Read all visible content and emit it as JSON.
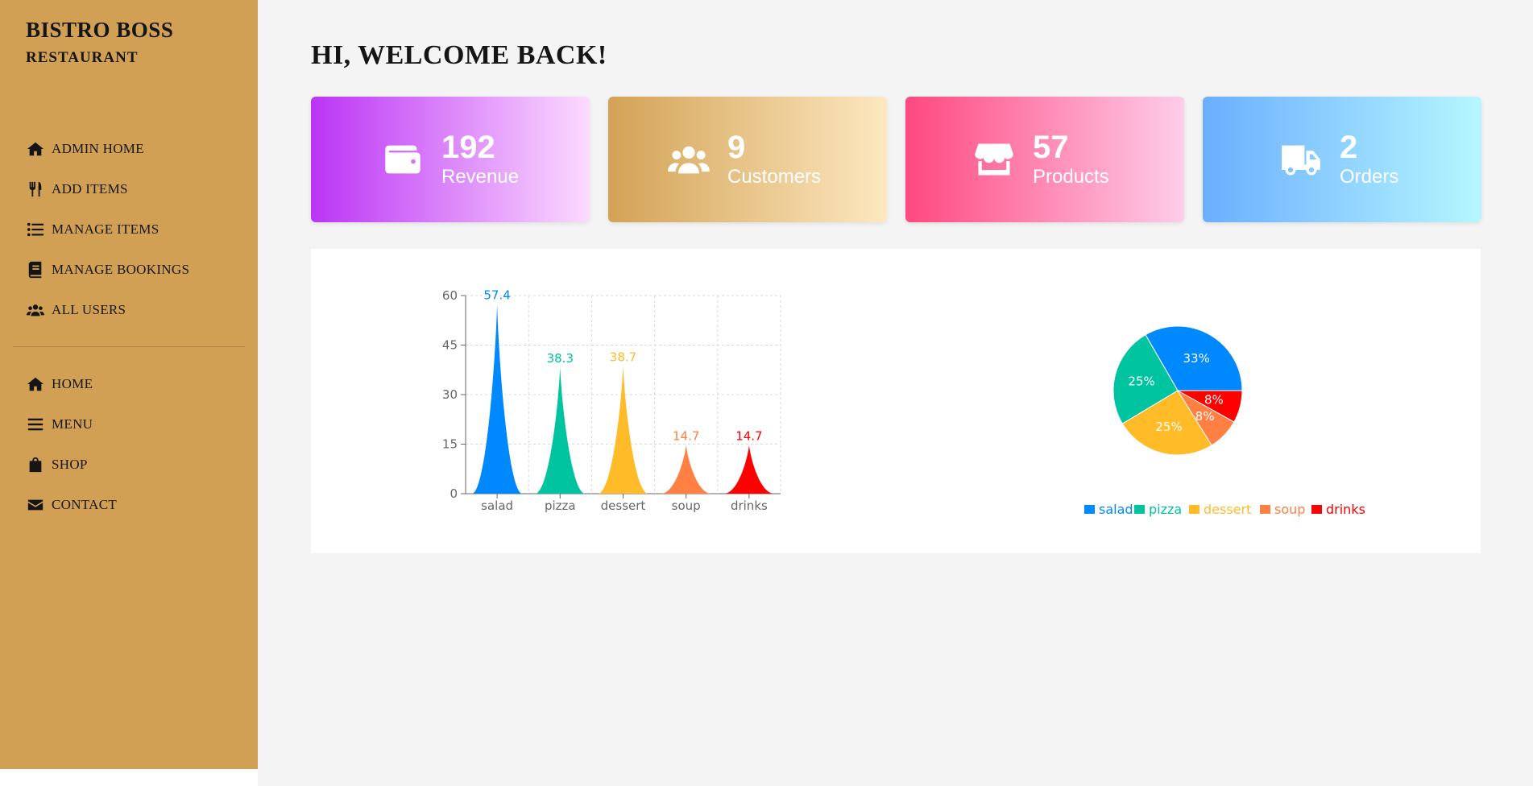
{
  "brand": {
    "name": "BISTRO BOSS",
    "subtitle": "RESTAURANT"
  },
  "sidebar": {
    "admin_items": [
      {
        "label": "ADMIN HOME",
        "icon": "home-icon"
      },
      {
        "label": "ADD ITEMS",
        "icon": "utensils-icon"
      },
      {
        "label": "MANAGE ITEMS",
        "icon": "list-icon"
      },
      {
        "label": "MANAGE BOOKINGS",
        "icon": "book-icon"
      },
      {
        "label": "ALL USERS",
        "icon": "users-icon"
      }
    ],
    "site_items": [
      {
        "label": "HOME",
        "icon": "home-icon"
      },
      {
        "label": "MENU",
        "icon": "menu-icon"
      },
      {
        "label": "SHOP",
        "icon": "shopping-bag-icon"
      },
      {
        "label": "CONTACT",
        "icon": "envelope-icon"
      }
    ]
  },
  "main": {
    "welcome": "HI, WELCOME BACK!"
  },
  "stats": [
    {
      "value": "192",
      "label": "Revenue",
      "icon": "wallet-icon",
      "gradient": [
        "#bb34f5",
        "#fcdbff"
      ]
    },
    {
      "value": "9",
      "label": "Customers",
      "icon": "users-icon",
      "gradient": [
        "#d3a256",
        "#fde8c0"
      ]
    },
    {
      "value": "57",
      "label": "Products",
      "icon": "store-icon",
      "gradient": [
        "#fe4880",
        "#fecde9"
      ]
    },
    {
      "value": "2",
      "label": "Orders",
      "icon": "truck-icon",
      "gradient": [
        "#6aaeff",
        "#b6f7ff"
      ]
    }
  ],
  "chart_data": [
    {
      "type": "bar",
      "categories": [
        "salad",
        "pizza",
        "dessert",
        "soup",
        "drinks"
      ],
      "values": [
        57.4,
        38.3,
        38.7,
        14.7,
        14.7
      ],
      "data_labels": [
        "57.4",
        "38.3",
        "38.7",
        "14.7",
        "14.7"
      ],
      "colors": [
        "#0088FE",
        "#00C49F",
        "#FFBB28",
        "#FF8042",
        "#FF0000"
      ],
      "ylim": [
        0,
        60
      ],
      "yticks": [
        0,
        15,
        30,
        45,
        60
      ],
      "grid": true,
      "bar_shape": "triangle-spike"
    },
    {
      "type": "pie",
      "labels": [
        "salad",
        "pizza",
        "dessert",
        "soup",
        "drinks"
      ],
      "values": [
        33,
        25,
        25,
        8,
        8
      ],
      "slice_labels": [
        "33%",
        "25%",
        "25%",
        "8%",
        "8%"
      ],
      "colors": [
        "#0088FE",
        "#00C49F",
        "#FFBB28",
        "#FF8042",
        "#FF0000"
      ],
      "legend": "bottom"
    }
  ]
}
